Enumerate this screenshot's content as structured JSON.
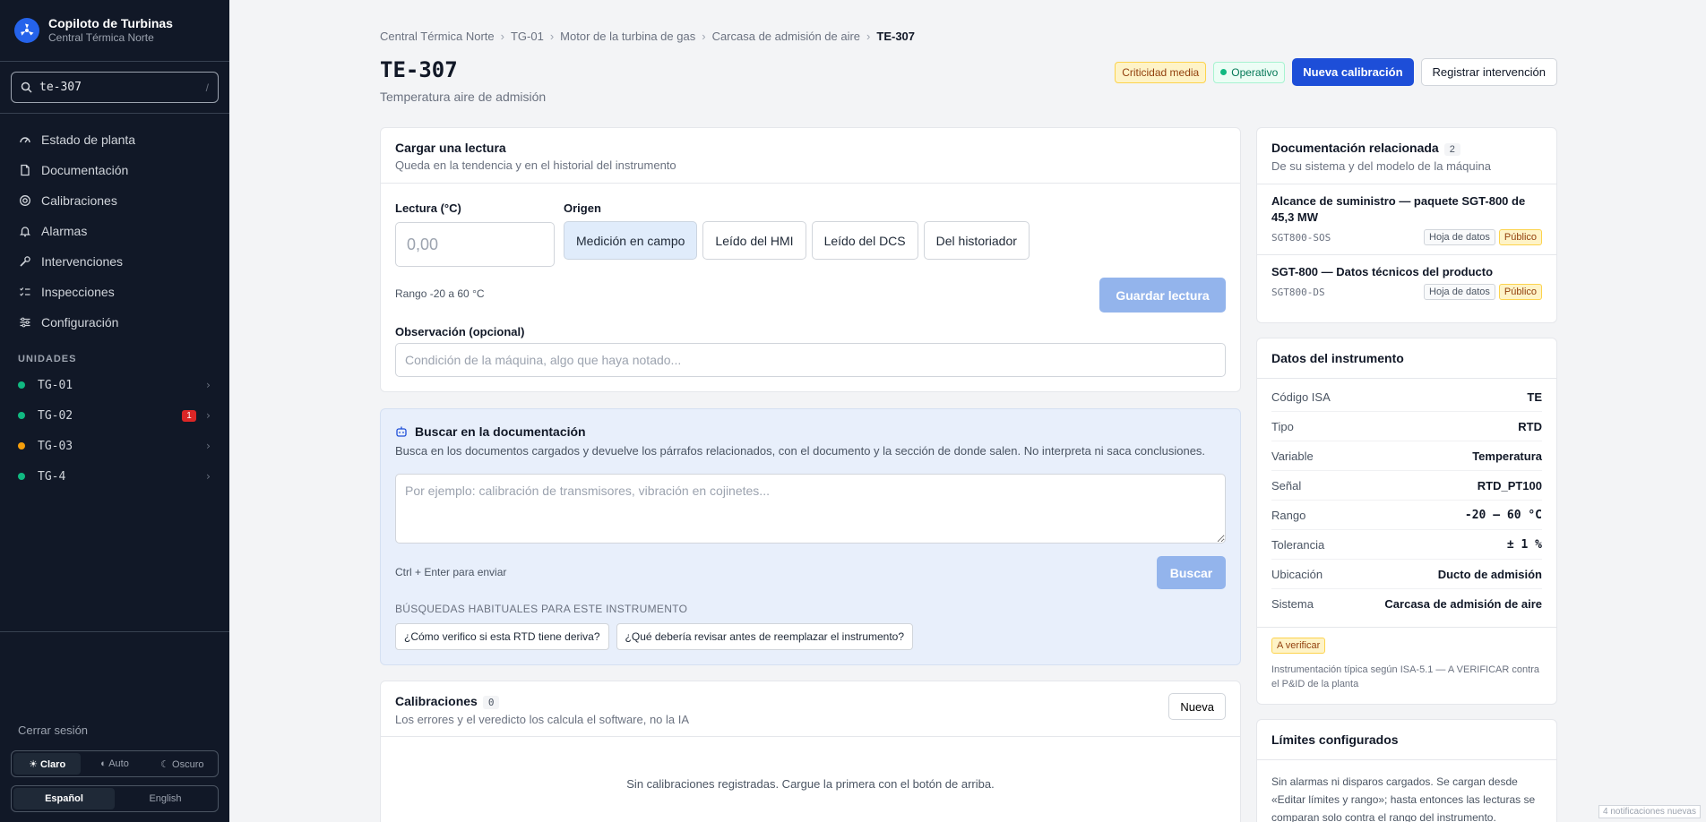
{
  "brand": {
    "title": "Copiloto de Turbinas",
    "subtitle": "Central Térmica Norte"
  },
  "search": {
    "value": "te-307",
    "shortcut": "/"
  },
  "nav": [
    {
      "label": "Estado de planta",
      "icon": "gauge-icon"
    },
    {
      "label": "Documentación",
      "icon": "document-icon"
    },
    {
      "label": "Calibraciones",
      "icon": "target-icon"
    },
    {
      "label": "Alarmas",
      "icon": "bell-icon"
    },
    {
      "label": "Intervenciones",
      "icon": "wrench-icon"
    },
    {
      "label": "Inspecciones",
      "icon": "checklist-icon"
    },
    {
      "label": "Configuración",
      "icon": "sliders-icon"
    }
  ],
  "units_section": "UNIDADES",
  "units": [
    {
      "name": "TG-01",
      "status_color": "#10b981",
      "count": ""
    },
    {
      "name": "TG-02",
      "status_color": "#10b981",
      "count": "1"
    },
    {
      "name": "TG-03",
      "status_color": "#f59e0b",
      "count": ""
    },
    {
      "name": "TG-4",
      "status_color": "#10b981",
      "count": ""
    }
  ],
  "logout": "Cerrar sesión",
  "theme": {
    "light": "☀ Claro",
    "auto": "◐ Auto",
    "dark": "☾ Oscuro",
    "selected": "Claro"
  },
  "lang": {
    "es": "Español",
    "en": "English",
    "selected": "Español"
  },
  "breadcrumb": [
    "Central Térmica Norte",
    "TG-01",
    "Motor de la turbina de gas",
    "Carcasa de admisión de aire",
    "TE-307"
  ],
  "page": {
    "title": "TE-307",
    "subtitle": "Temperatura aire de admisión"
  },
  "header": {
    "criticality": "Criticidad media",
    "status": "Operativo",
    "new_calibration": "Nueva calibración",
    "register_intervention": "Registrar intervención"
  },
  "reading": {
    "title": "Cargar una lectura",
    "desc": "Queda en la tendencia y en el historial del instrumento",
    "value_label": "Lectura (°C)",
    "value_placeholder": "0,00",
    "origin_label": "Origen",
    "origins": [
      "Medición en campo",
      "Leído del HMI",
      "Leído del DCS",
      "Del historiador"
    ],
    "selected_origin": "Medición en campo",
    "range_hint": "Rango -20 a 60 °C",
    "save": "Guardar lectura",
    "obs_label": "Observación (opcional)",
    "obs_placeholder": "Condición de la máquina, algo que haya notado..."
  },
  "ai": {
    "title": "Buscar en la documentación",
    "desc": "Busca en los documentos cargados y devuelve los párrafos relacionados, con el documento y la sección de donde salen. No interpreta ni saca conclusiones.",
    "placeholder": "Por ejemplo: calibración de transmisores, vibración en cojinetes...",
    "hint": "Ctrl + Enter para enviar",
    "submit": "Buscar",
    "section": "BÚSQUEDAS HABITUALES PARA ESTE INSTRUMENTO",
    "suggestions": [
      "¿Cómo verifico si esta RTD tiene deriva?",
      "¿Qué debería revisar antes de reemplazar el instrumento?"
    ]
  },
  "calibrations": {
    "title": "Calibraciones",
    "count": "0",
    "desc": "Los errores y el veredicto los calcula el software, no la IA",
    "new": "Nueva",
    "empty": "Sin calibraciones registradas. Cargue la primera con el botón de arriba."
  },
  "docs": {
    "title": "Documentación relacionada",
    "count": "2",
    "desc": "De su sistema y del modelo de la máquina",
    "items": [
      {
        "title": "Alcance de suministro — paquete SGT-800 de 45,3 MW",
        "code": "SGT800-SOS",
        "type": "Hoja de datos",
        "visibility": "Público"
      },
      {
        "title": "SGT-800 — Datos técnicos del producto",
        "code": "SGT800-DS",
        "type": "Hoja de datos",
        "visibility": "Público"
      }
    ]
  },
  "instrument": {
    "title": "Datos del instrumento",
    "rows": [
      {
        "k": "Código ISA",
        "v": "TE",
        "mono": false
      },
      {
        "k": "Tipo",
        "v": "RTD",
        "mono": false
      },
      {
        "k": "Variable",
        "v": "Temperatura",
        "mono": false
      },
      {
        "k": "Señal",
        "v": "RTD_PT100",
        "mono": false
      },
      {
        "k": "Rango",
        "v": "-20 – 60 °C",
        "mono": true
      },
      {
        "k": "Tolerancia",
        "v": "± 1 %",
        "mono": true
      },
      {
        "k": "Ubicación",
        "v": "Ducto de admisión",
        "mono": false
      },
      {
        "k": "Sistema",
        "v": "Carcasa de admisión de aire",
        "mono": false
      }
    ],
    "verify_badge": "A verificar",
    "verify_note": "Instrumentación típica según ISA-5.1 — A VERIFICAR contra el P&ID de la planta"
  },
  "limits": {
    "title": "Límites configurados",
    "body": "Sin alarmas ni disparos cargados. Se cargan desde «Editar límites y rango»; hasta entonces las lecturas se comparan solo contra el rango del instrumento."
  },
  "toast": "4 notificaciones nuevas",
  "colors": {
    "accent": "#1d4ed8",
    "sidebar": "#111827",
    "ai_bg": "#e8effb"
  }
}
